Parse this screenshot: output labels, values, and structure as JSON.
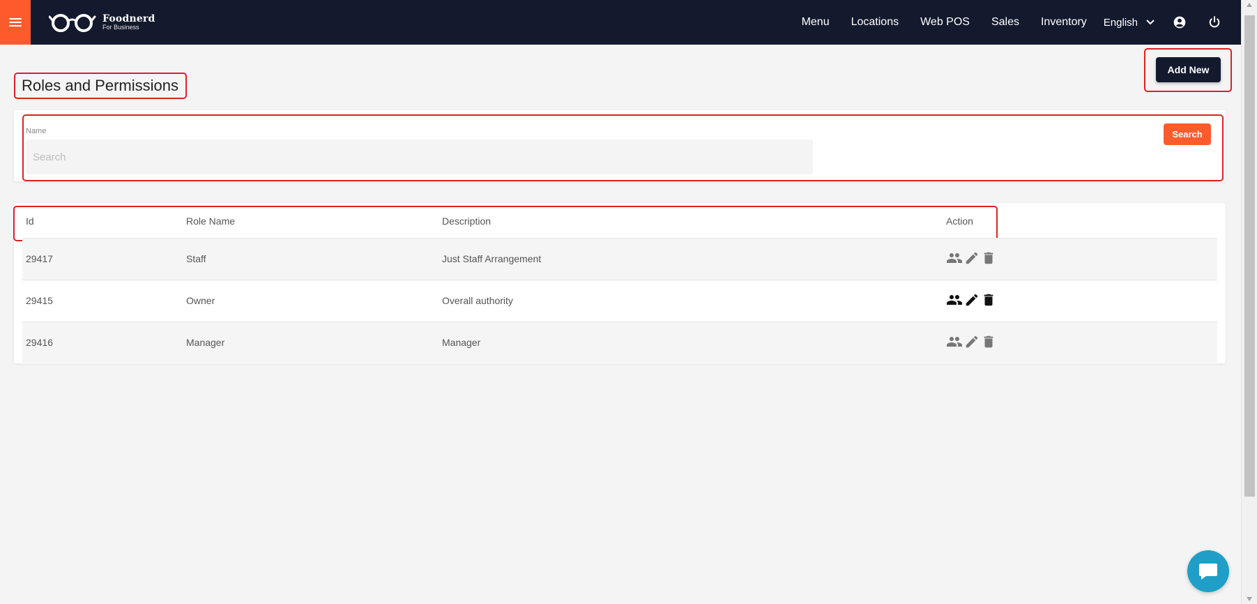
{
  "navbar": {
    "brand": {
      "name": "Foodnerd",
      "tagline": "For Business"
    },
    "links": [
      {
        "label": "Menu"
      },
      {
        "label": "Locations"
      },
      {
        "label": "Web POS"
      },
      {
        "label": "Sales"
      },
      {
        "label": "Inventory"
      }
    ],
    "language": "English",
    "icons": {
      "menu": "hamburger-icon",
      "language_toggle": "chevron-down-icon",
      "account": "account-circle-icon",
      "logout": "power-icon"
    },
    "colors": {
      "background": "#141a2e",
      "accent": "#fe5b2c"
    }
  },
  "page": {
    "title": "Roles and Permissions",
    "add_new_label": "Add New"
  },
  "filter": {
    "name_label": "Name",
    "search_placeholder": "Search",
    "search_value": "",
    "search_button_label": "Search"
  },
  "table": {
    "columns": [
      "Id",
      "Role Name",
      "Description",
      "Action"
    ],
    "rows": [
      {
        "id": "29417",
        "role_name": "Staff",
        "description": "Just Staff Arrangement"
      },
      {
        "id": "29415",
        "role_name": "Owner",
        "description": "Overall authority"
      },
      {
        "id": "29416",
        "role_name": "Manager",
        "description": "Manager"
      }
    ],
    "action_icons": [
      "people-icon",
      "pencil-icon",
      "trash-icon"
    ]
  },
  "chat": {
    "icon": "chat-bubble-icon",
    "color": "#1f9fc7"
  }
}
